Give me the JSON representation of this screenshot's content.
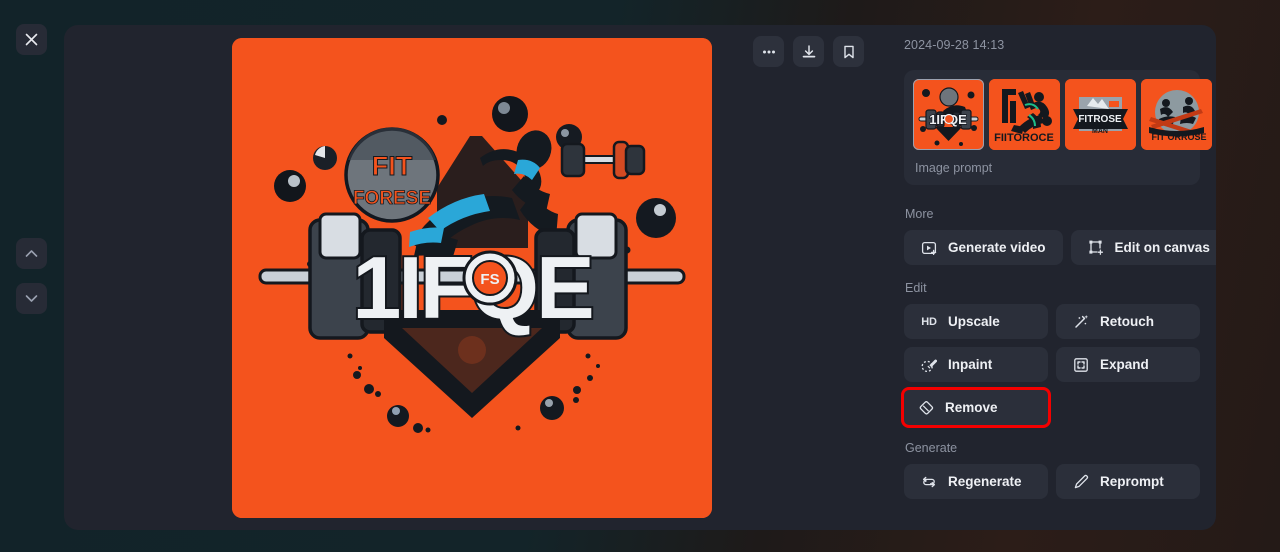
{
  "window": {
    "close_label": "Close",
    "prev_label": "Previous image",
    "next_label": "Next image"
  },
  "toolbar": {
    "more_label": "More options",
    "download_label": "Download",
    "bookmark_label": "Bookmark"
  },
  "panel": {
    "timestamp": "2024-09-28 14:13",
    "prompt_label": "Image prompt",
    "thumbnails": [
      {
        "alt": "fitness logo with barbell and athlete",
        "selected": true
      },
      {
        "alt": "running athlete silhouette logo FIITOROCE"
      },
      {
        "alt": "badge logo FITROSE"
      },
      {
        "alt": "skiing figures logo FIT ORROSE"
      }
    ],
    "sections": [
      {
        "title": "More",
        "buttons": [
          {
            "label": "Generate video",
            "icon": "video-plus-icon"
          },
          {
            "label": "Edit on canvas",
            "icon": "canvas-transform-icon"
          }
        ]
      },
      {
        "title": "Edit",
        "buttons": [
          {
            "label": "Upscale",
            "icon": "hd-icon"
          },
          {
            "label": "Retouch",
            "icon": "magic-wand-icon"
          },
          {
            "label": "Inpaint",
            "icon": "inpaint-brush-icon"
          },
          {
            "label": "Expand",
            "icon": "expand-icon"
          },
          {
            "label": "Remove",
            "icon": "eraser-icon",
            "highlighted": true
          }
        ]
      },
      {
        "title": "Generate",
        "buttons": [
          {
            "label": "Regenerate",
            "icon": "refresh-loop-icon"
          },
          {
            "label": "Reprompt",
            "icon": "pencil-icon"
          }
        ]
      }
    ]
  },
  "image": {
    "alt": "Orange fitness logo: barbell with FIFQE text, athlete, FIT FORESE circle",
    "background_color": "#f4531d",
    "text_primary": "FIT",
    "text_secondary": "FORESE",
    "text_logo": "1IFQE"
  },
  "colors": {
    "accent_orange": "#f4531d",
    "panel_bg": "#21242e",
    "card_bg": "#282c37",
    "button_bg": "#2b2f3a",
    "highlight_red": "#f40000",
    "text_muted": "#8d93a1",
    "text_primary": "#eef0f4"
  }
}
